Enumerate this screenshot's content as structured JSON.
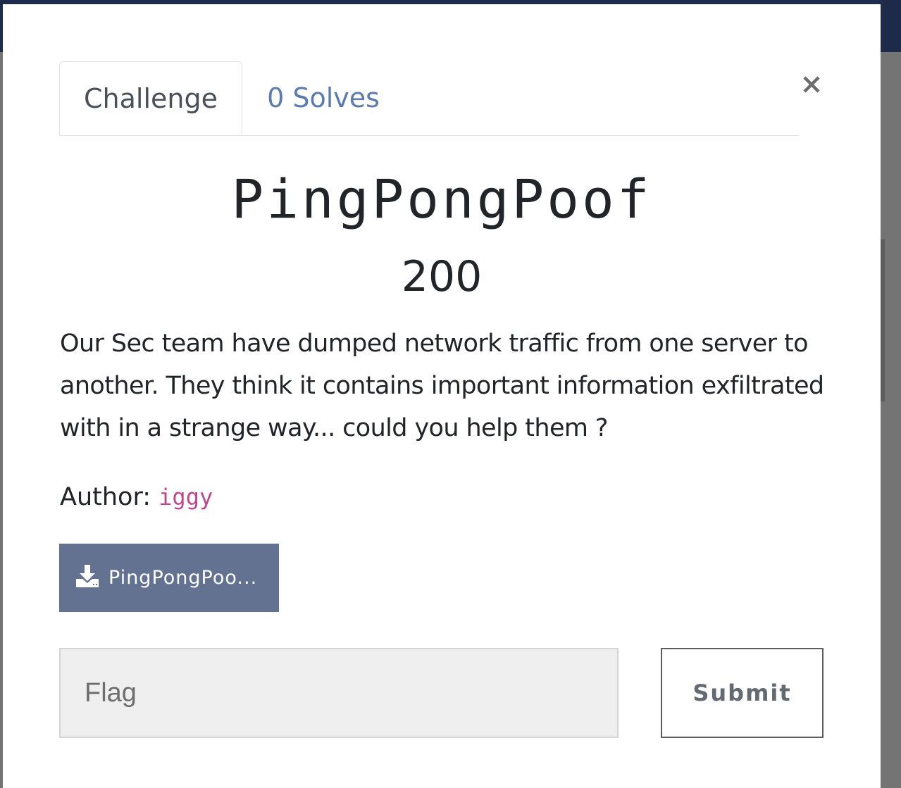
{
  "modal": {
    "tabs": [
      {
        "label": "Challenge",
        "active": true
      },
      {
        "label": "0 Solves",
        "active": false
      }
    ],
    "close_icon": "close-icon",
    "title": "PingPongPoof",
    "points": "200",
    "description": "Our Sec team have dumped network traffic from one server to another. They think it contains important information exfiltrated with in a strange way... could you help them ?",
    "author_label": "Author:",
    "author_name": "iggy",
    "download": {
      "icon": "download-icon",
      "label": "PingPongPoo..."
    },
    "flag_input": {
      "placeholder": "Flag",
      "value": ""
    },
    "submit_label": "Submit"
  },
  "colors": {
    "accent": "#627290",
    "tab_link": "#5c7bb0",
    "author_code": "#c0468c",
    "topbar": "#1d2a4a"
  }
}
